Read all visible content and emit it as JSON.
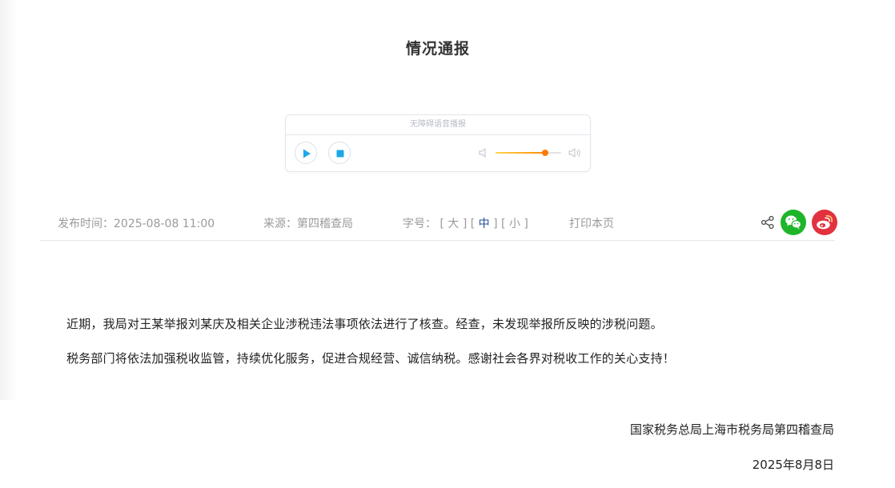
{
  "article": {
    "title": "情况通报",
    "paragraphs": [
      "近期，我局对王某举报刘某庆及相关企业涉税违法事项依法进行了核查。经查，未发现举报所反映的涉税问题。",
      "税务部门将依法加强税收监管，持续优化服务，促进合规经营、诚信纳税。感谢社会各界对税收工作的关心支持！"
    ],
    "signature": {
      "org": "国家税务总局上海市税务局第四稽查局",
      "date": "2025年8月8日"
    }
  },
  "audio_player": {
    "caption": "无障碍语音播报",
    "volume_level": 0.75,
    "icons": {
      "play": "play-icon",
      "stop": "stop-icon",
      "volume_low": "volume-low-icon",
      "volume_high": "volume-high-icon"
    }
  },
  "meta": {
    "publish_time": "发布时间：2025-08-08 11:00",
    "source": "来源：第四稽查局",
    "font_size_label": "字号：",
    "font_sizes": {
      "large": "大",
      "medium": "中",
      "small": "小"
    },
    "active_font_size": "medium",
    "print_label": "打印本页"
  },
  "share": {
    "icons": [
      "share-icon",
      "wechat-icon",
      "weibo-icon"
    ]
  },
  "colors": {
    "player_accent": "#1ea7e8",
    "volume_fill_start": "#ffd34d",
    "volume_fill_end": "#ff8a00",
    "active_font_size": "#1e4d96",
    "wechat": "#1fb52a",
    "weibo": "#e2323f",
    "meta_text": "#9a9a9a",
    "body_text": "#222222"
  }
}
